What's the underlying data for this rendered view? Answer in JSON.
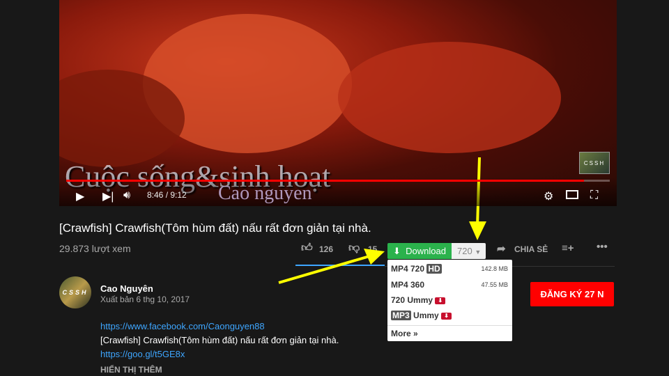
{
  "video": {
    "watermark_title": "Cuộc sống&sinh hoạt",
    "watermark_sub": "Cao nguyen",
    "channel_logo": "CSSH",
    "time": "8:46 / 9:12",
    "progress": 0.953,
    "icons": [
      "play-icon",
      "next-icon",
      "volume-icon",
      "settings-icon",
      "theater-icon",
      "fullscreen-icon"
    ]
  },
  "title": "[Crawfish] Crawfish(Tôm hùm đất) nấu rất đơn giản tại nhà.",
  "views": "29.873 lượt xem",
  "actions": {
    "likes": "126",
    "dislikes": "15",
    "share": "CHIA SẺ"
  },
  "download": {
    "label": "Download",
    "quality": "720",
    "options": [
      {
        "label": "MP4 720",
        "badge": "HD",
        "size": "142.8 MB"
      },
      {
        "label": "MP4 360",
        "size": "47.55 MB"
      },
      {
        "label": "720 Ummy"
      },
      {
        "badge": "MP3",
        "label": "Ummy"
      }
    ],
    "more": "More »"
  },
  "channel": {
    "name": "Cao Nguyên",
    "published": "Xuất bản 6 thg 10, 2017",
    "avatar_text": "CSSH",
    "subscribe": "ĐĂNG KÝ  27 N"
  },
  "description": {
    "line1": "https://www.facebook.com/Caonguyen88",
    "line2": "[Crawfish] Crawfish(Tôm hùm đất) nấu rất đơn giản tại nhà.",
    "line3": "https://goo.gl/t5GE8x",
    "show_more": "HIỂN THỊ THÊM"
  },
  "colors": {
    "download": "#2bb24c",
    "subscribe": "#ff0000",
    "link": "#3ea6ff",
    "arrow": "#ffff00"
  }
}
